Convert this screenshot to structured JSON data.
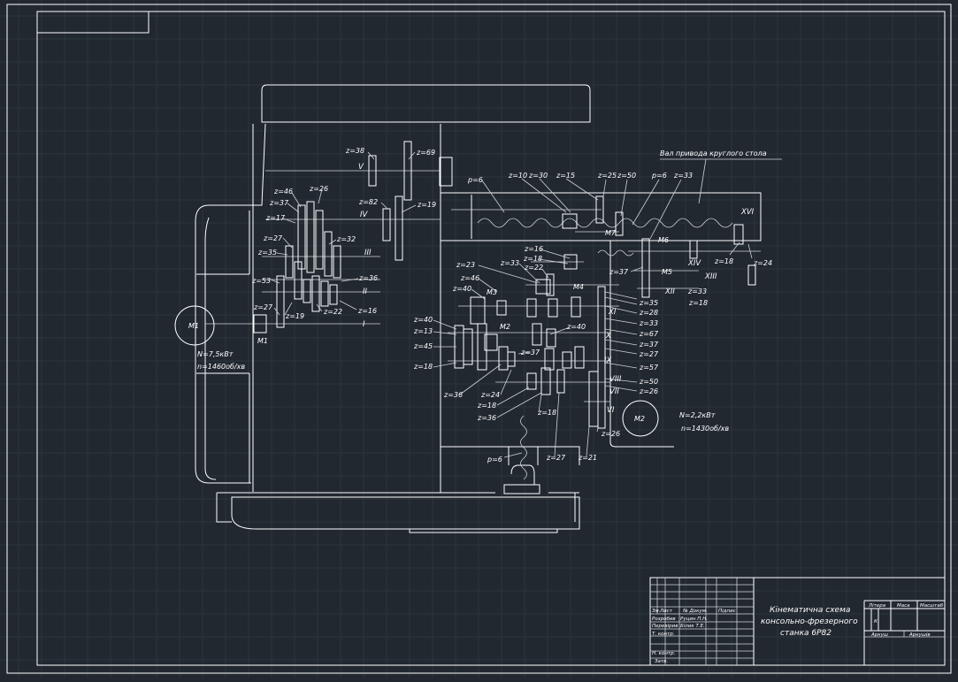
{
  "drawing": {
    "annotation_shaft": "Вал привода круглого стола",
    "motor1": {
      "name": "M1",
      "power": "N=7,5кВт",
      "speed": "n=1460об/хв"
    },
    "motor2": {
      "name": "M2",
      "power": "N=2,2кВт",
      "speed": "n=1430об/хв"
    }
  },
  "title_block": {
    "title_line1": "Кінематична схема",
    "title_line2": "консольно-фрезерного",
    "title_line3": "станка 6Р82",
    "header_cells": [
      "Зм.",
      "Лист",
      "№ Докум.",
      "Підпис",
      "Дата"
    ],
    "roles": [
      "Розробив",
      "Перевірив",
      "Т. контр.",
      "",
      "Н. контр.",
      "Затв."
    ],
    "names": [
      "Руцин П.Н.",
      "Білик Т.Е.",
      "",
      "",
      "",
      ""
    ],
    "litera_label": "Літера",
    "mass_label": "Маса",
    "scale_label": "Масштаб",
    "litera_value": "К",
    "sheet_label": "Аркуш",
    "sheets_label": "Аркушів"
  },
  "gear_labels": [
    "z=38",
    "z=69",
    "z=82",
    "z=19",
    "z=46",
    "z=26",
    "z=37",
    "z=17",
    "z=27",
    "z=32",
    "z=35",
    "z=36",
    "z=53",
    "z=16",
    "z=27",
    "z=19",
    "z=22",
    "z=10",
    "z=30",
    "z=15",
    "z=25",
    "z=50",
    "z=33",
    "z=16",
    "z=18",
    "z=24",
    "z=37",
    "z=23",
    "z=33",
    "z=22",
    "z=46",
    "z=40",
    "z=33",
    "z=18",
    "z=35",
    "z=28",
    "z=33",
    "z=67",
    "z=37",
    "z=27",
    "z=57",
    "z=50",
    "z=26",
    "z=26",
    "z=40",
    "z=13",
    "z=45",
    "z=18",
    "z=40",
    "z=37",
    "z=36",
    "z=24",
    "z=18",
    "z=36",
    "z=18",
    "z=27",
    "z=21",
    "p=6",
    "p=6",
    "p=6",
    "z=18"
  ],
  "shaft_labels": [
    "V",
    "IV",
    "III",
    "II",
    "I",
    "XVI",
    "XIV",
    "XIII",
    "XII",
    "XI",
    "X",
    "IX",
    "VIII",
    "VII",
    "VI"
  ],
  "clutch_labels": [
    "M1",
    "M2",
    "M3",
    "M4",
    "M5",
    "M6",
    "M7"
  ]
}
